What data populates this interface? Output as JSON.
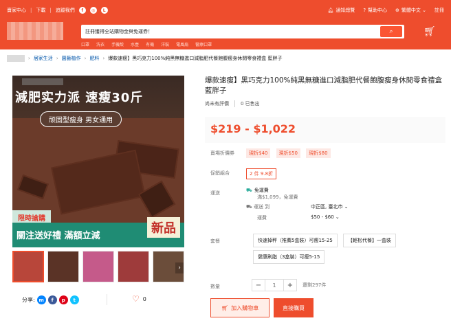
{
  "topbar": {
    "seller_center": "賣家中心",
    "download": "下載",
    "follow": "追蹤我們",
    "notifications": "通知總覽",
    "help": "幫助中心",
    "language": "繁體中文",
    "register": "註冊"
  },
  "search": {
    "placeholder": "註冊獲得全站購物金與免運券！",
    "hotwords": [
      "口罩",
      "洗衣",
      "手機殼",
      "水壺",
      "有機",
      "洋裝",
      "電風扇",
      "醫療口罩"
    ]
  },
  "breadcrumb": [
    "居家生活",
    "園藝植作",
    "肥料",
    "爆款速瘦】黑巧克力100%純黑無糖進口減脂肥代餐飽腹瘦身休閒零食禮盒 藍胖子"
  ],
  "hero": {
    "banner_text": "減肥实力派 速瘦30斤",
    "pill": "顽固型瘦身 男女通用",
    "sale_tag": "限時搶購",
    "bottom_text": "關注送好禮 滿額立減",
    "new_badge": "新品"
  },
  "thumbs": [
    {
      "label": "thumb-1",
      "color": "#b8463a"
    },
    {
      "label": "thumb-2",
      "color": "#5a3326"
    },
    {
      "label": "thumb-3",
      "color": "#c55a8a"
    },
    {
      "label": "thumb-4",
      "color": "#9e3b3b"
    },
    {
      "label": "thumb-5",
      "color": "#6b4d3a"
    }
  ],
  "share": {
    "label": "分享:",
    "likes": "0"
  },
  "product": {
    "title": "爆款速瘦】黑巧克力100%純黑無糖進口減脂肥代餐飽腹瘦身休閒零食禮盒 藍胖子",
    "rating": "尚未有評價",
    "sold": "0 已售出",
    "price": "$219 - $1,022"
  },
  "promo": {
    "label": "賣場折價券",
    "coupons": [
      "現折$40",
      "現折$50",
      "現折$80"
    ]
  },
  "combo": {
    "label": "促銷組合",
    "tag": "2 件 9.8折"
  },
  "shipping": {
    "label": "運送",
    "free": "免運費",
    "free_detail": "滿$1,099，免運費",
    "to_label": "運送 到",
    "to_value": "中正區, 臺北市",
    "fee_label": "運費",
    "fee_value": "$50 - $60"
  },
  "variant": {
    "label": "套餐",
    "options": [
      "快速掉秤（推薦5盒裝）可瘦15-25",
      "【輕松代餐】一盒裝",
      "健康刷脂（3盒裝）可瘦5-15"
    ]
  },
  "quantity": {
    "label": "數量",
    "value": "1",
    "minus": "−",
    "plus": "+",
    "stock": "還剩297件"
  },
  "actions": {
    "add_to_cart": "加入購物車",
    "buy_now": "直接購買"
  },
  "colors": {
    "accent": "#ee4d2d",
    "teal": "#26aa99"
  }
}
